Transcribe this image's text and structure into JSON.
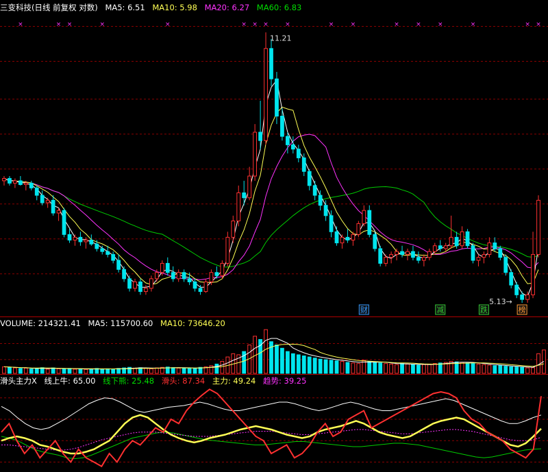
{
  "header": {
    "title": "三变科技(日线 前复权 对数)",
    "ma5": "MA5: 6.51",
    "ma10": "MA10: 5.98",
    "ma20": "MA20: 6.27",
    "ma60": "MA60: 6.83"
  },
  "volume_panel": {
    "title": "VOLUME: 214321.41",
    "ma5": "MA5: 115700.60",
    "ma10": "MA10: 73646.20"
  },
  "indicator_panel": {
    "title": "滑头主力X",
    "line_up": "线上牛: 65.00",
    "line_down": "线下熊: 25.48",
    "slippery": "滑头: 87.34",
    "main_force": "主力: 49.24",
    "trend": "趋势: 39.25"
  },
  "colors": {
    "up": "#ff3030",
    "down": "#00e5ee",
    "ma5": "#ffffff",
    "ma10": "#ffff55",
    "ma20": "#ff33ff",
    "ma60": "#00cc00",
    "grid": "#8b0000"
  },
  "chart_data": [
    {
      "type": "candlestick",
      "panel": "price",
      "scale": "log",
      "ylim": [
        5.0,
        11.6
      ],
      "annotations": [
        {
          "text": "11.21",
          "kind": "high"
        },
        {
          "text": "5.13",
          "kind": "low"
        }
      ],
      "event_markers": [
        "财",
        "减",
        "跌",
        "榜"
      ],
      "candles": [
        [
          7.3,
          7.4,
          7.2,
          7.35
        ],
        [
          7.35,
          7.4,
          7.2,
          7.25
        ],
        [
          7.25,
          7.35,
          7.15,
          7.3
        ],
        [
          7.3,
          7.4,
          7.2,
          7.22
        ],
        [
          7.22,
          7.3,
          7.1,
          7.25
        ],
        [
          7.25,
          7.3,
          7.1,
          7.15
        ],
        [
          7.15,
          7.2,
          6.9,
          7.0
        ],
        [
          7.0,
          7.1,
          6.8,
          6.85
        ],
        [
          6.85,
          6.95,
          6.75,
          6.9
        ],
        [
          6.9,
          7.0,
          6.6,
          6.65
        ],
        [
          6.65,
          6.75,
          6.5,
          6.7
        ],
        [
          6.7,
          6.75,
          6.2,
          6.25
        ],
        [
          6.25,
          6.35,
          6.1,
          6.15
        ],
        [
          6.15,
          6.25,
          6.05,
          6.2
        ],
        [
          6.2,
          6.3,
          6.05,
          6.12
        ],
        [
          6.12,
          6.2,
          6.0,
          6.15
        ],
        [
          6.15,
          6.25,
          6.05,
          6.08
        ],
        [
          6.08,
          6.15,
          5.95,
          6.0
        ],
        [
          6.0,
          6.05,
          5.9,
          5.95
        ],
        [
          5.95,
          6.05,
          5.85,
          5.9
        ],
        [
          5.9,
          5.95,
          5.75,
          5.8
        ],
        [
          5.8,
          5.9,
          5.6,
          5.65
        ],
        [
          5.65,
          5.7,
          5.45,
          5.5
        ],
        [
          5.5,
          5.55,
          5.3,
          5.35
        ],
        [
          5.35,
          5.5,
          5.3,
          5.45
        ],
        [
          5.45,
          5.5,
          5.25,
          5.3
        ],
        [
          5.3,
          5.4,
          5.25,
          5.35
        ],
        [
          5.35,
          5.55,
          5.3,
          5.5
        ],
        [
          5.5,
          5.65,
          5.45,
          5.6
        ],
        [
          5.6,
          5.8,
          5.55,
          5.75
        ],
        [
          5.75,
          5.85,
          5.55,
          5.6
        ],
        [
          5.6,
          5.7,
          5.45,
          5.5
        ],
        [
          5.5,
          5.65,
          5.45,
          5.6
        ],
        [
          5.6,
          5.65,
          5.45,
          5.5
        ],
        [
          5.5,
          5.6,
          5.4,
          5.45
        ],
        [
          5.45,
          5.5,
          5.3,
          5.35
        ],
        [
          5.35,
          5.4,
          5.25,
          5.3
        ],
        [
          5.3,
          5.5,
          5.28,
          5.45
        ],
        [
          5.45,
          5.65,
          5.4,
          5.6
        ],
        [
          5.6,
          5.7,
          5.5,
          5.55
        ],
        [
          5.55,
          5.8,
          5.5,
          5.75
        ],
        [
          5.75,
          6.3,
          5.7,
          6.2
        ],
        [
          6.2,
          6.6,
          6.1,
          6.5
        ],
        [
          6.5,
          7.2,
          6.4,
          7.05
        ],
        [
          7.05,
          7.3,
          6.8,
          6.95
        ],
        [
          6.95,
          7.6,
          6.9,
          7.4
        ],
        [
          7.4,
          8.6,
          7.3,
          8.4
        ],
        [
          8.4,
          9.2,
          8.0,
          8.2
        ],
        [
          8.2,
          11.21,
          8.1,
          10.7
        ],
        [
          10.7,
          11.0,
          9.6,
          9.8
        ],
        [
          9.8,
          10.0,
          8.6,
          8.8
        ],
        [
          8.8,
          9.0,
          8.2,
          8.3
        ],
        [
          8.3,
          8.4,
          7.9,
          8.1
        ],
        [
          8.1,
          8.3,
          7.9,
          8.0
        ],
        [
          8.0,
          8.1,
          7.7,
          7.8
        ],
        [
          7.8,
          7.9,
          7.4,
          7.5
        ],
        [
          7.5,
          7.55,
          7.1,
          7.2
        ],
        [
          7.2,
          7.3,
          6.9,
          7.0
        ],
        [
          7.0,
          7.1,
          6.7,
          6.8
        ],
        [
          6.8,
          6.9,
          6.5,
          6.6
        ],
        [
          6.6,
          6.7,
          6.2,
          6.3
        ],
        [
          6.3,
          6.4,
          6.05,
          6.1
        ],
        [
          6.1,
          6.25,
          6.0,
          6.2
        ],
        [
          6.2,
          6.35,
          6.1,
          6.15
        ],
        [
          6.15,
          6.3,
          6.05,
          6.25
        ],
        [
          6.25,
          6.5,
          6.2,
          6.45
        ],
        [
          6.45,
          6.8,
          6.4,
          6.7
        ],
        [
          6.7,
          6.8,
          6.2,
          6.25
        ],
        [
          6.25,
          6.3,
          5.95,
          6.0
        ],
        [
          6.0,
          6.05,
          5.7,
          5.75
        ],
        [
          5.75,
          5.9,
          5.7,
          5.85
        ],
        [
          5.85,
          5.95,
          5.75,
          5.9
        ],
        [
          5.9,
          6.0,
          5.8,
          5.95
        ],
        [
          5.95,
          6.05,
          5.85,
          5.9
        ],
        [
          5.9,
          6.0,
          5.8,
          5.95
        ],
        [
          5.95,
          6.05,
          5.8,
          5.85
        ],
        [
          5.85,
          5.95,
          5.75,
          5.8
        ],
        [
          5.8,
          5.9,
          5.7,
          5.85
        ],
        [
          5.85,
          6.0,
          5.8,
          5.95
        ],
        [
          5.95,
          6.1,
          5.9,
          6.05
        ],
        [
          6.05,
          6.15,
          5.95,
          6.0
        ],
        [
          6.0,
          6.1,
          5.95,
          6.05
        ],
        [
          6.05,
          6.6,
          6.0,
          6.2
        ],
        [
          6.2,
          6.3,
          6.0,
          6.05
        ],
        [
          6.05,
          6.4,
          6.0,
          6.3
        ],
        [
          6.3,
          6.35,
          6.0,
          6.05
        ],
        [
          6.05,
          6.1,
          5.75,
          5.8
        ],
        [
          5.8,
          5.9,
          5.7,
          5.85
        ],
        [
          5.85,
          5.95,
          5.75,
          5.9
        ],
        [
          5.9,
          6.2,
          5.85,
          6.1
        ],
        [
          6.1,
          6.2,
          5.95,
          6.0
        ],
        [
          6.0,
          6.05,
          5.8,
          5.85
        ],
        [
          5.85,
          5.9,
          5.55,
          5.6
        ],
        [
          5.6,
          5.65,
          5.35,
          5.4
        ],
        [
          5.4,
          5.45,
          5.2,
          5.25
        ],
        [
          5.25,
          5.3,
          5.13,
          5.18
        ],
        [
          5.18,
          5.3,
          5.13,
          5.25
        ],
        [
          5.25,
          6.3,
          5.2,
          5.9
        ],
        [
          5.9,
          7.0,
          5.85,
          6.9
        ]
      ]
    },
    {
      "type": "bar",
      "panel": "volume",
      "values": [
        60,
        55,
        50,
        45,
        48,
        40,
        45,
        52,
        38,
        50,
        42,
        40,
        45,
        38,
        42,
        36,
        40,
        45,
        38,
        42,
        40,
        45,
        50,
        55,
        48,
        52,
        46,
        42,
        50,
        55,
        58,
        52,
        48,
        45,
        50,
        46,
        55,
        60,
        70,
        85,
        110,
        150,
        180,
        170,
        200,
        260,
        340,
        310,
        400,
        290,
        260,
        230,
        200,
        180,
        170,
        160,
        150,
        140,
        130,
        125,
        120,
        115,
        110,
        100,
        95,
        90,
        120,
        110,
        100,
        95,
        90,
        85,
        80,
        90,
        85,
        80,
        75,
        80,
        85,
        90,
        95,
        100,
        110,
        105,
        100,
        95,
        90,
        85,
        80,
        75,
        70,
        72,
        65,
        60,
        58,
        55,
        50,
        52,
        180,
        214
      ],
      "ylim": [
        0,
        420
      ]
    },
    {
      "type": "line",
      "panel": "indicator",
      "ylim": [
        0,
        100
      ],
      "series": [
        {
          "name": "滑头",
          "values": [
            45,
            55,
            35,
            20,
            30,
            15,
            25,
            35,
            20,
            10,
            25,
            15,
            10,
            5,
            20,
            10,
            25,
            35,
            30,
            40,
            50,
            45,
            60,
            55,
            70,
            80,
            88,
            95,
            90,
            80,
            70,
            60,
            50,
            40,
            35,
            20,
            25,
            30,
            15,
            20,
            30,
            45,
            55,
            40,
            45,
            60,
            65,
            70,
            50,
            55,
            60,
            65,
            70,
            75,
            80,
            85,
            90,
            92,
            90,
            85,
            70,
            60,
            55,
            45,
            40,
            35,
            25,
            20,
            15,
            25,
            87
          ]
        },
        {
          "name": "主力",
          "values": [
            35,
            38,
            40,
            38,
            35,
            30,
            28,
            25,
            22,
            20,
            20,
            22,
            25,
            30,
            35,
            45,
            55,
            62,
            65,
            62,
            55,
            48,
            42,
            38,
            35,
            33,
            35,
            38,
            40,
            42,
            45,
            48,
            50,
            52,
            50,
            48,
            45,
            42,
            40,
            38,
            40,
            45,
            48,
            50,
            52,
            55,
            58,
            55,
            50,
            45,
            42,
            40,
            38,
            40,
            45,
            50,
            55,
            58,
            60,
            62,
            60,
            55,
            50,
            45,
            40,
            35,
            30,
            28,
            32,
            40,
            49
          ]
        },
        {
          "name": "趋势",
          "values": [
            30,
            30,
            29,
            28,
            27,
            26,
            25,
            24,
            24,
            25,
            27,
            30,
            33,
            36,
            38,
            40,
            42,
            44,
            45,
            45,
            45,
            44,
            43,
            42,
            41,
            40,
            40,
            40,
            41,
            42,
            43,
            44,
            45,
            46,
            46,
            46,
            45,
            44,
            43,
            42,
            42,
            43,
            44,
            45,
            46,
            47,
            48,
            48,
            47,
            46,
            45,
            44,
            43,
            43,
            44,
            45,
            46,
            47,
            48,
            48,
            47,
            46,
            44,
            42,
            40,
            38,
            36,
            35,
            35,
            36,
            39
          ]
        },
        {
          "name": "线上牛",
          "values": [
            75,
            70,
            62,
            55,
            50,
            48,
            50,
            55,
            60,
            66,
            72,
            78,
            82,
            85,
            84,
            80,
            75,
            70,
            68,
            70,
            72,
            74,
            75,
            76,
            78,
            80,
            78,
            75,
            72,
            70,
            70,
            72,
            74,
            76,
            78,
            80,
            80,
            78,
            75,
            72,
            70,
            72,
            75,
            78,
            80,
            78,
            75,
            72,
            70,
            70,
            72,
            74,
            76,
            78,
            80,
            82,
            84,
            82,
            78,
            74,
            70,
            66,
            62,
            58,
            55,
            55,
            58,
            62,
            65
          ]
        },
        {
          "name": "线下熊",
          "values": [
            40,
            38,
            35,
            30,
            25,
            22,
            20,
            18,
            15,
            14,
            15,
            18,
            22,
            26,
            30,
            34,
            38,
            40,
            42,
            44,
            45,
            44,
            42,
            40,
            38,
            36,
            35,
            34,
            33,
            32,
            31,
            30,
            30,
            31,
            32,
            33,
            34,
            34,
            33,
            32,
            31,
            30,
            29,
            28,
            28,
            29,
            30,
            31,
            32,
            32,
            31,
            30,
            28,
            26,
            24,
            22,
            20,
            18,
            16,
            15,
            16,
            18,
            20,
            22,
            24,
            25,
            25.5
          ]
        }
      ]
    }
  ]
}
